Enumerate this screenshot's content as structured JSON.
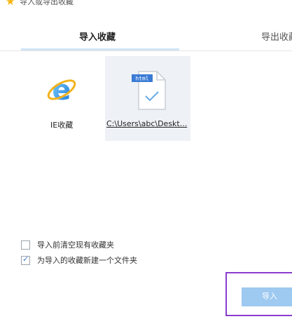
{
  "window": {
    "title": "导入或导出收藏",
    "icon": "star-icon"
  },
  "tabs": [
    {
      "label": "导入收藏",
      "active": true
    },
    {
      "label": "导出收藏",
      "active": false
    }
  ],
  "sources": [
    {
      "label": "IE收藏",
      "icon": "ie-browser-icon",
      "selected": false
    },
    {
      "label": "C:\\Users\\abc\\Deskt...",
      "icon": "html-file-icon",
      "selected": true
    }
  ],
  "options": [
    {
      "label": "导入前清空现有收藏夹",
      "checked": false
    },
    {
      "label": "为导入的收藏新建一个文件夹",
      "checked": true
    }
  ],
  "buttons": {
    "import_label": "导入"
  },
  "colors": {
    "accent": "#3a7bd5",
    "button": "#9ec9f0",
    "highlight": "#8a3ccf",
    "star": "#f5b400"
  }
}
